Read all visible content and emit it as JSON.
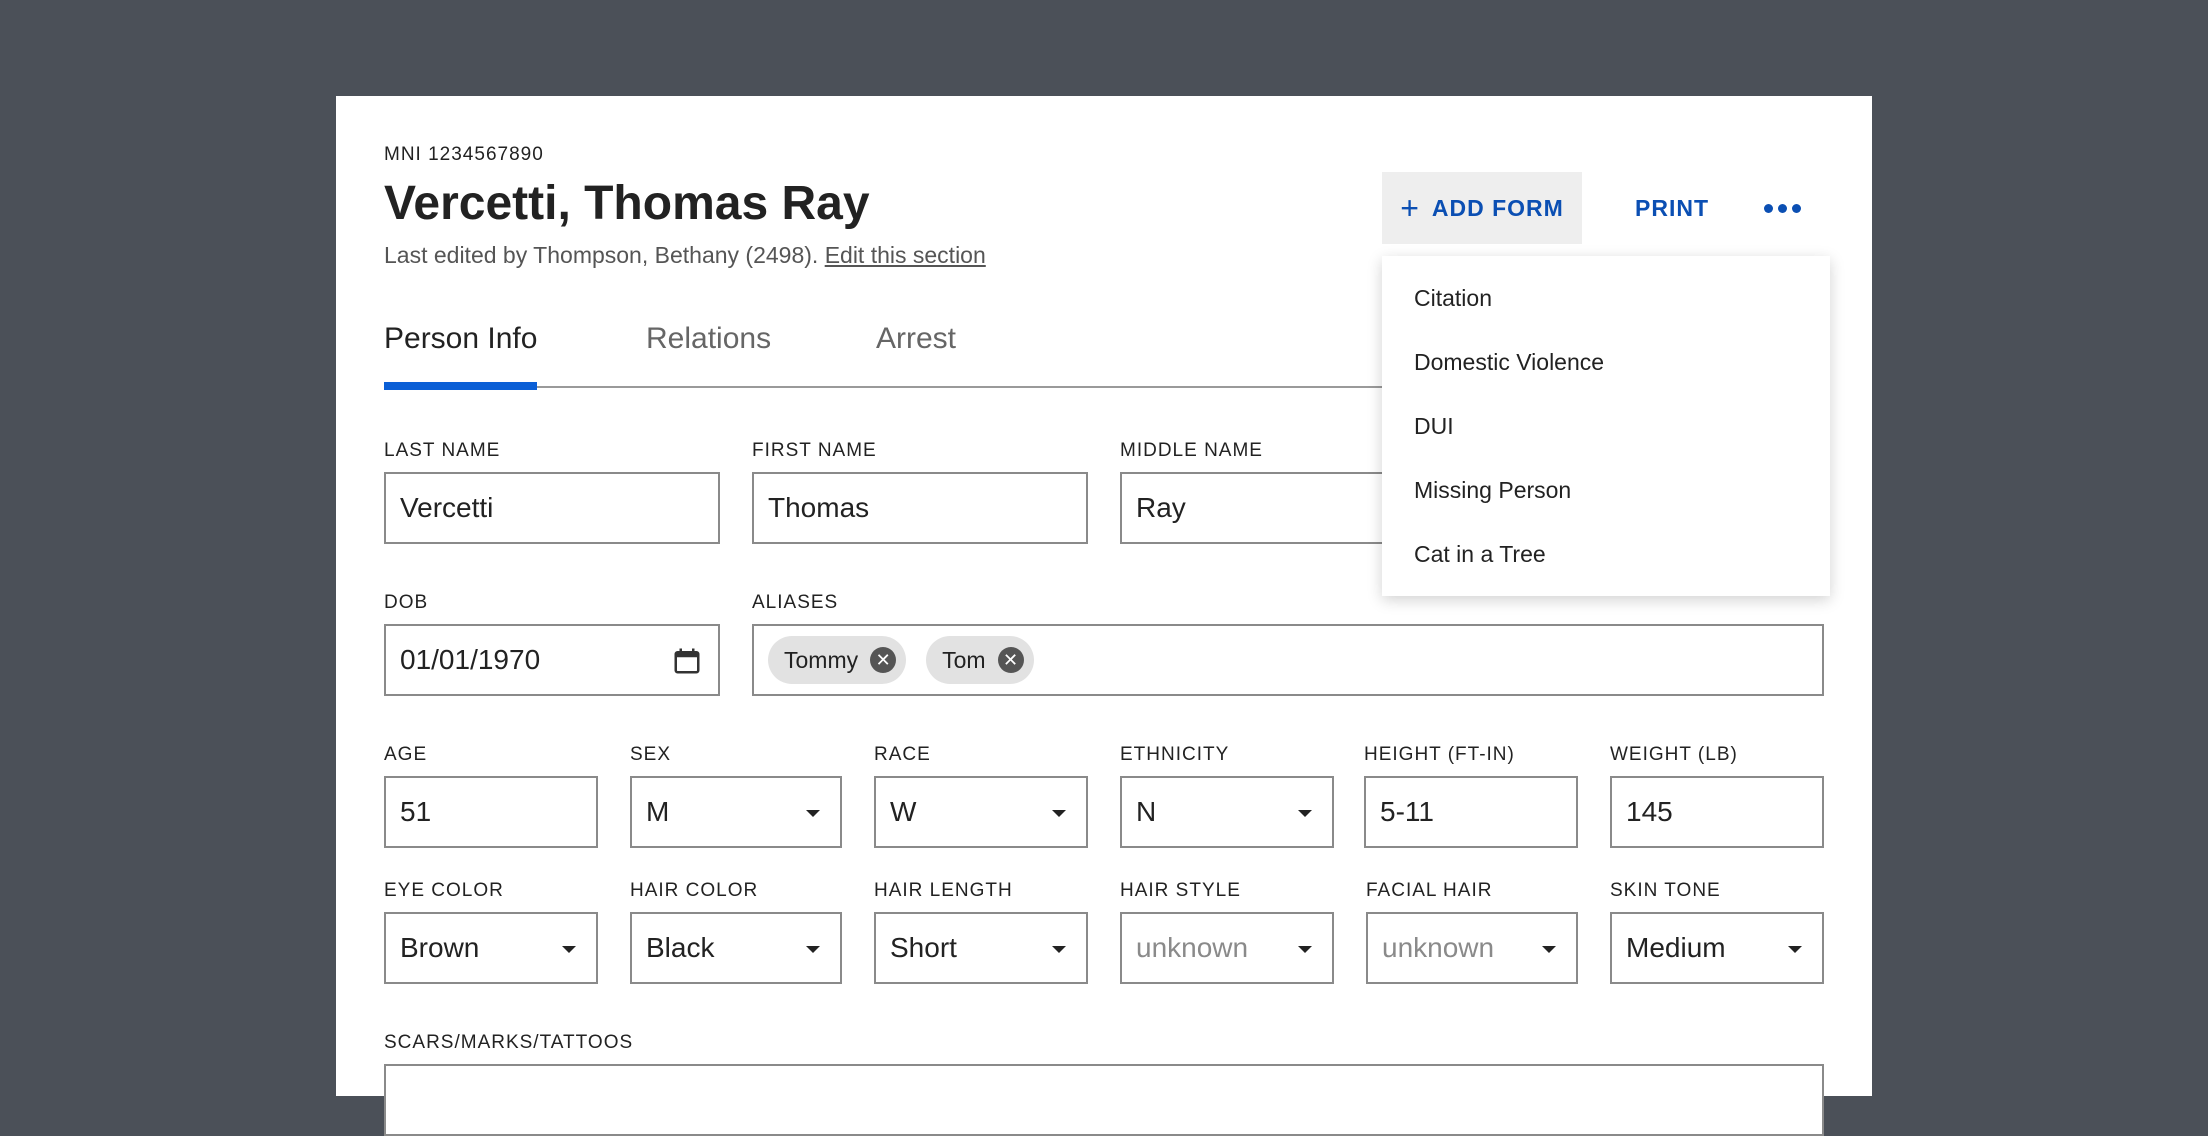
{
  "header": {
    "mni": "MNI 1234567890",
    "title": "Vercetti, Thomas Ray",
    "last_edited": "Last edited by Thompson, Bethany (2498).",
    "edit_link": "Edit this section"
  },
  "actions": {
    "add_form": "ADD FORM",
    "print": "PRINT"
  },
  "add_form_menu": [
    "Citation",
    "Domestic Violence",
    "DUI",
    "Missing Person",
    "Cat in a Tree"
  ],
  "tabs": [
    "Person Info",
    "Relations",
    "Arrest"
  ],
  "active_tab": "Person Info",
  "fields": {
    "last_name": {
      "label": "LAST NAME",
      "value": "Vercetti"
    },
    "first_name": {
      "label": "FIRST NAME",
      "value": "Thomas"
    },
    "middle_name": {
      "label": "MIDDLE NAME",
      "value": "Ray"
    },
    "dob": {
      "label": "DOB",
      "value": "01/01/1970"
    },
    "aliases": {
      "label": "ALIASES",
      "values": [
        "Tommy",
        "Tom"
      ]
    },
    "age": {
      "label": "AGE",
      "value": "51"
    },
    "sex": {
      "label": "SEX",
      "value": "M"
    },
    "race": {
      "label": "RACE",
      "value": "W"
    },
    "ethnicity": {
      "label": "ETHNICITY",
      "value": "N"
    },
    "height": {
      "label": "HEIGHT (FT-IN)",
      "value": "5-11"
    },
    "weight": {
      "label": "WEIGHT (LB)",
      "value": "145"
    },
    "eye_color": {
      "label": "EYE COLOR",
      "value": "Brown"
    },
    "hair_color": {
      "label": "HAIR COLOR",
      "value": "Black"
    },
    "hair_length": {
      "label": "HAIR LENGTH",
      "value": "Short"
    },
    "hair_style": {
      "label": "HAIR STYLE",
      "placeholder": "unknown"
    },
    "facial_hair": {
      "label": "FACIAL HAIR",
      "placeholder": "unknown"
    },
    "skin_tone": {
      "label": "SKIN TONE",
      "value": "Medium"
    },
    "scars": {
      "label": "SCARS/MARKS/TATTOOS"
    }
  },
  "colors": {
    "accent": "#0b4fb3",
    "tab_indicator": "#0b5fd6",
    "backdrop": "#4b5058"
  },
  "icons": [
    "plus-icon",
    "more-horizontal-icon",
    "calendar-icon",
    "remove-chip-icon",
    "chevron-down-icon"
  ]
}
